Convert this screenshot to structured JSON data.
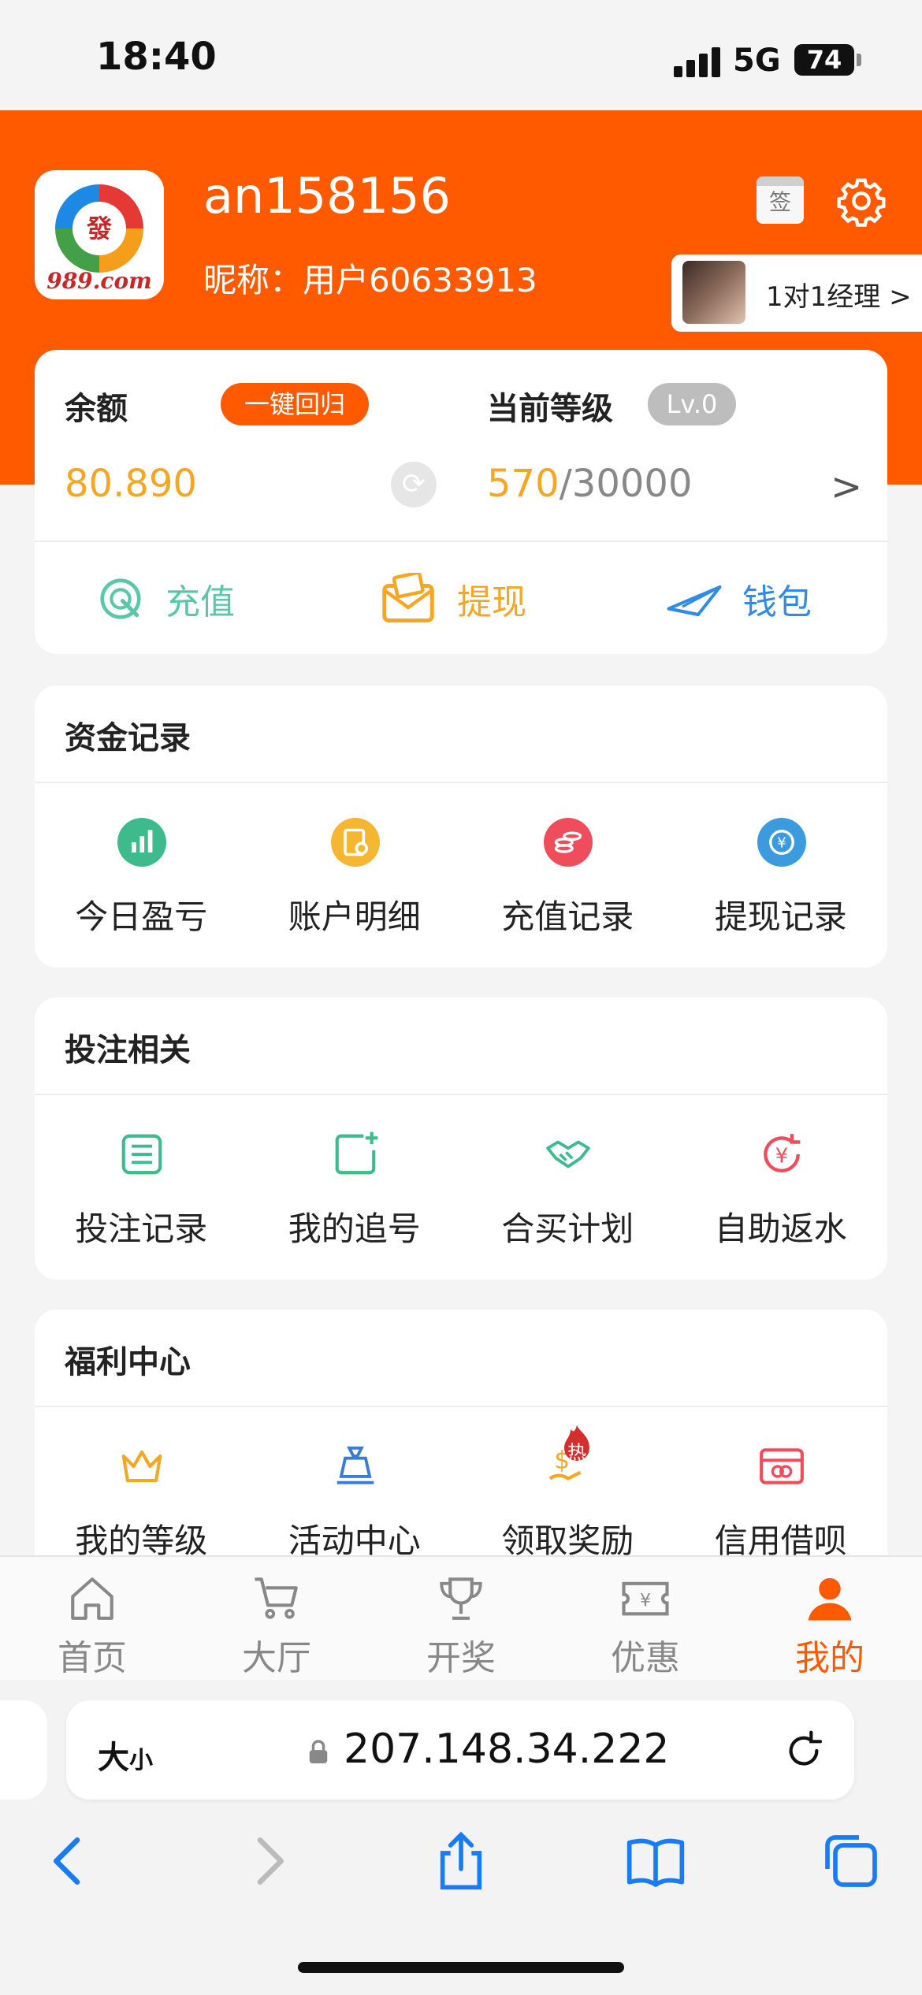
{
  "status_bar": {
    "time": "18:40",
    "network": "5G",
    "battery": "74"
  },
  "header": {
    "logo_char": "發",
    "logo_text": "989.com",
    "username": "an158156",
    "nickname": "昵称：用户60633913",
    "signin_label": "签",
    "manager_label": "1对1经理 >"
  },
  "balance": {
    "title": "余额",
    "recall_button": "一键回归",
    "value": "80.890",
    "level_title": "当前等级",
    "level_badge": "Lv.0",
    "level_current": "570",
    "level_total": "/30000",
    "arrow": ">"
  },
  "actions": [
    {
      "label": "充值",
      "color": "#5cc7a8",
      "icon": "recharge-icon"
    },
    {
      "label": "提现",
      "color": "#f5a623",
      "icon": "withdraw-icon"
    },
    {
      "label": "钱包",
      "color": "#2f8be6",
      "icon": "wallet-icon"
    }
  ],
  "funds": {
    "title": "资金记录",
    "items": [
      {
        "label": "今日盈亏",
        "icon": "chart-icon",
        "color": "#3dbb8d"
      },
      {
        "label": "账户明细",
        "icon": "detail-icon",
        "color": "#f5b731"
      },
      {
        "label": "充值记录",
        "icon": "coins-icon",
        "color": "#ef4d5b"
      },
      {
        "label": "提现记录",
        "icon": "exchange-icon",
        "color": "#3b9bdc"
      }
    ]
  },
  "betting": {
    "title": "投注相关",
    "items": [
      {
        "label": "投注记录",
        "icon": "list-icon",
        "color": "#3dbb8d"
      },
      {
        "label": "我的追号",
        "icon": "add-note-icon",
        "color": "#3dbb8d"
      },
      {
        "label": "合买计划",
        "icon": "handshake-icon",
        "color": "#3dbb8d"
      },
      {
        "label": "自助返水",
        "icon": "rebate-icon",
        "color": "#ef4d5b"
      }
    ]
  },
  "welfare": {
    "title": "福利中心",
    "items": [
      {
        "label": "我的等级",
        "icon": "crown-icon",
        "color": "#f5a623"
      },
      {
        "label": "活动中心",
        "icon": "gift-icon",
        "color": "#3b7bd8"
      },
      {
        "label": "领取奖励",
        "icon": "reward-icon",
        "color": "#f5a623"
      },
      {
        "label": "信用借呗",
        "icon": "card-icon",
        "color": "#ef4d5b"
      }
    ],
    "hot_badge": "热"
  },
  "tabs": [
    {
      "label": "首页",
      "icon": "home-icon"
    },
    {
      "label": "大厅",
      "icon": "cart-icon"
    },
    {
      "label": "开奖",
      "icon": "trophy-icon"
    },
    {
      "label": "优惠",
      "icon": "coupon-icon"
    },
    {
      "label": "我的",
      "icon": "person-icon",
      "active": true
    }
  ],
  "browser": {
    "text_size": "大",
    "text_size_small": "小",
    "address": "207.148.34.222"
  },
  "colors": {
    "brand": "#ff5a00",
    "gold": "#f5a623"
  }
}
